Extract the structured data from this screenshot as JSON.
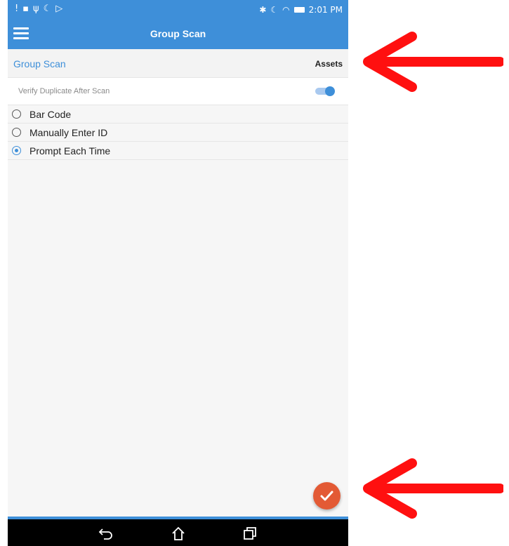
{
  "status_bar": {
    "left_icons": [
      "notification-icon",
      "image-icon",
      "usb-icon",
      "moon-icon",
      "play-store-icon"
    ],
    "right_icons": [
      "bluetooth-icon",
      "moon-icon",
      "wifi-icon",
      "battery-icon"
    ],
    "time": "2:01 PM"
  },
  "app_bar": {
    "title": "Group Scan",
    "menu_icon": "hamburger-menu-icon"
  },
  "subheader": {
    "left": "Group Scan",
    "right": "Assets"
  },
  "verify_toggle": {
    "label": "Verify Duplicate After Scan",
    "on": true
  },
  "scan_options": [
    {
      "label": "Bar Code",
      "selected": false
    },
    {
      "label": "Manually Enter ID",
      "selected": false
    },
    {
      "label": "Prompt Each Time",
      "selected": true
    }
  ],
  "fab": {
    "icon": "checkmark-icon"
  },
  "nav_bar": [
    "back-icon",
    "home-icon",
    "recent-apps-icon"
  ],
  "colors": {
    "primary": "#3e8fd9",
    "fab": "#e35a35",
    "annotation_arrow": "#ff1010"
  }
}
